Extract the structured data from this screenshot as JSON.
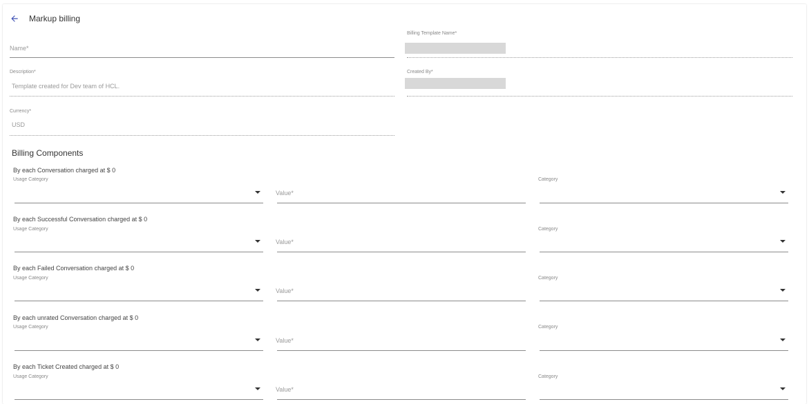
{
  "header": {
    "title": "Markup billing",
    "back_icon": "arrow-left-icon"
  },
  "form": {
    "name": {
      "placeholder": "Name*"
    },
    "billing_template_name": {
      "label": "Billing Template Name*"
    },
    "description": {
      "label": "Description*",
      "value": "Template created for Dev team of HCL."
    },
    "created_by": {
      "label": "Created By*"
    },
    "currency": {
      "label": "Currency*",
      "value": "USD"
    }
  },
  "section_title": "Billing Components",
  "components": [
    {
      "title": "By each Conversation charged at $ 0",
      "usage_label": "Usage Category",
      "value_placeholder": "Value*",
      "category_label": "Category"
    },
    {
      "title": "By each Successful Conversation charged at $ 0",
      "usage_label": "Usage Category",
      "value_placeholder": "Value*",
      "category_label": "Category"
    },
    {
      "title": "By each Failed Conversation charged at $ 0",
      "usage_label": "Usage Category",
      "value_placeholder": "Value*",
      "category_label": "Category"
    },
    {
      "title": "By each unrated Conversation charged at $ 0",
      "usage_label": "Usage Category",
      "value_placeholder": "Value*",
      "category_label": "Category"
    },
    {
      "title": "By each Ticket Created charged at $ 0",
      "usage_label": "Usage Category",
      "value_placeholder": "Value*",
      "category_label": "Category"
    }
  ]
}
